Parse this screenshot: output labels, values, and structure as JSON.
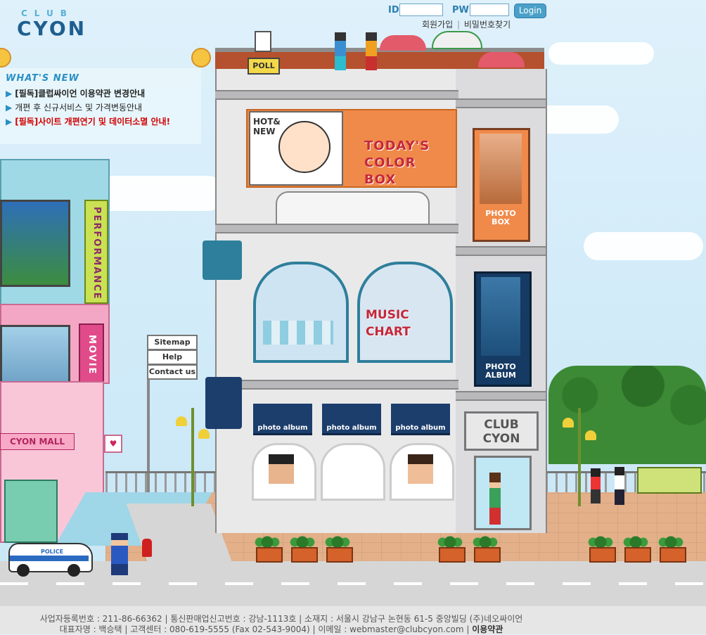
{
  "logo": {
    "top": "CLUB",
    "main": "CYON"
  },
  "login": {
    "id_label": "ID",
    "pw_label": "PW",
    "button": "Login",
    "join": "회원가입",
    "separator": "|",
    "find_pw": "비밀번호찾기"
  },
  "whats_new": {
    "title": "WHAT'S NEW",
    "items": [
      {
        "text": "[필독]클럽싸이언 이용약관 변경안내"
      },
      {
        "text": "개편 후 신규서비스 및 가격변동안내"
      },
      {
        "text": "[필독]사이트 개편연기 및 데이터소멸 안내!"
      }
    ]
  },
  "building": {
    "poll": "POLL",
    "hot_new": "HOT&\nNEW",
    "todays_color_box": [
      "TODAY'S",
      "COLOR",
      "BOX"
    ],
    "photo_box": [
      "PHOTO",
      "BOX"
    ],
    "photo_album_side": [
      "PHOTO",
      "ALBUM"
    ],
    "music_chart": [
      "MUSIC",
      "CHART"
    ],
    "photo_album_awnings": [
      "photo album",
      "photo album",
      "photo album"
    ],
    "club_cyon": [
      "CLUB",
      "CYON"
    ]
  },
  "left": {
    "performance": "PERFORMANCE",
    "movie": "MOVIE",
    "cyon_mall": "CYON MALL"
  },
  "nav_signs": [
    "Sitemap",
    "Help",
    "Contact us"
  ],
  "police": "POLICE",
  "footer": {
    "line1": "사업자등록번호 : 211-86-66362 | 통신판매업신고번호 : 강남-1113호 | 소재지 : 서울시 강남구 논현동 61-5 중앙빌딩 (주)네오싸이언",
    "line2_prefix": "대표자명 : 백승택 | 고객센터 : 080-619-5555 (Fax 02-543-9004) | 이메일 : webmaster@clubcyon.com |",
    "terms": "이용약관"
  },
  "colors": {
    "accent": "#2a8fc4",
    "red": "#d10000",
    "orange": "#f08a4a",
    "navy": "#1c3e6d"
  }
}
